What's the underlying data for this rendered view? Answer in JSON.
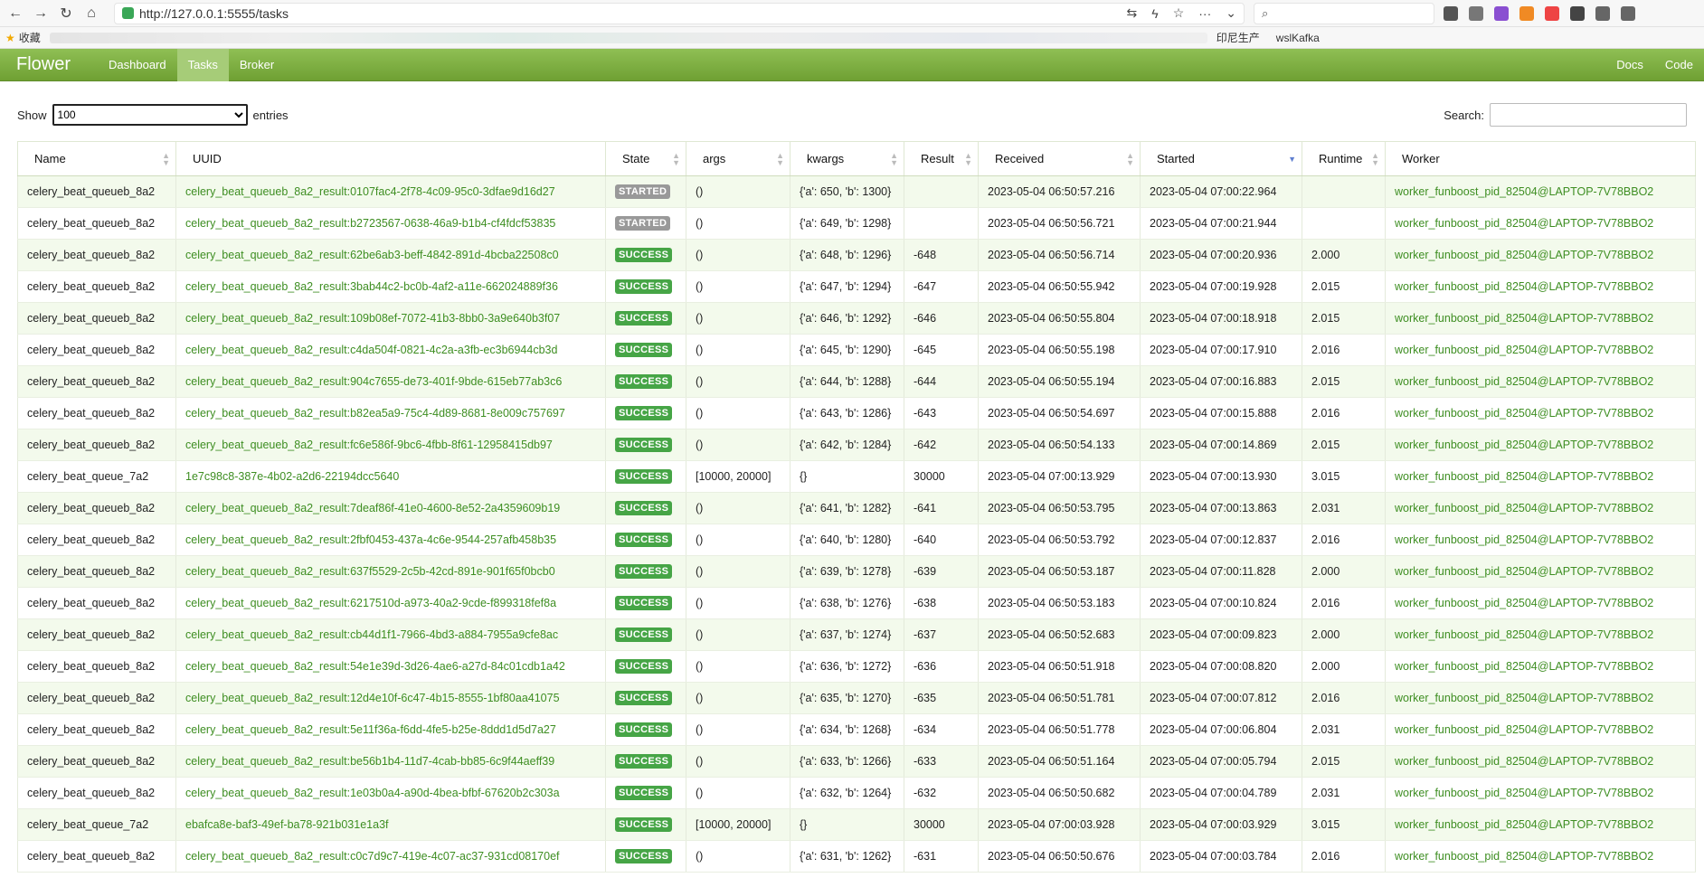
{
  "browser": {
    "url": "http://127.0.0.1:5555/tasks",
    "bookmarks": {
      "favorites": "收藏",
      "item1": "印尼生产",
      "item2": "wslKafka"
    }
  },
  "navbar": {
    "brand": "Flower",
    "links": [
      "Dashboard",
      "Tasks",
      "Broker"
    ],
    "active": "Tasks",
    "right_links": [
      "Docs",
      "Code"
    ]
  },
  "controls": {
    "show_label": "Show",
    "entries_value": "100",
    "entries_label": "entries",
    "search_label": "Search:",
    "search_value": ""
  },
  "table": {
    "columns": [
      "Name",
      "UUID",
      "State",
      "args",
      "kwargs",
      "Result",
      "Received",
      "Started",
      "Runtime",
      "Worker"
    ],
    "sorted_column": "Started",
    "rows": [
      [
        "celery_beat_queueb_8a2",
        "celery_beat_queueb_8a2_result:0107fac4-2f78-4c09-95c0-3dfae9d16d27",
        "STARTED",
        "()",
        "{'a': 650, 'b': 1300}",
        "",
        "2023-05-04 06:50:57.216",
        "2023-05-04 07:00:22.964",
        "",
        "worker_funboost_pid_82504@LAPTOP-7V78BBO2"
      ],
      [
        "celery_beat_queueb_8a2",
        "celery_beat_queueb_8a2_result:b2723567-0638-46a9-b1b4-cf4fdcf53835",
        "STARTED",
        "()",
        "{'a': 649, 'b': 1298}",
        "",
        "2023-05-04 06:50:56.721",
        "2023-05-04 07:00:21.944",
        "",
        "worker_funboost_pid_82504@LAPTOP-7V78BBO2"
      ],
      [
        "celery_beat_queueb_8a2",
        "celery_beat_queueb_8a2_result:62be6ab3-beff-4842-891d-4bcba22508c0",
        "SUCCESS",
        "()",
        "{'a': 648, 'b': 1296}",
        "-648",
        "2023-05-04 06:50:56.714",
        "2023-05-04 07:00:20.936",
        "2.000",
        "worker_funboost_pid_82504@LAPTOP-7V78BBO2"
      ],
      [
        "celery_beat_queueb_8a2",
        "celery_beat_queueb_8a2_result:3bab44c2-bc0b-4af2-a11e-662024889f36",
        "SUCCESS",
        "()",
        "{'a': 647, 'b': 1294}",
        "-647",
        "2023-05-04 06:50:55.942",
        "2023-05-04 07:00:19.928",
        "2.015",
        "worker_funboost_pid_82504@LAPTOP-7V78BBO2"
      ],
      [
        "celery_beat_queueb_8a2",
        "celery_beat_queueb_8a2_result:109b08ef-7072-41b3-8bb0-3a9e640b3f07",
        "SUCCESS",
        "()",
        "{'a': 646, 'b': 1292}",
        "-646",
        "2023-05-04 06:50:55.804",
        "2023-05-04 07:00:18.918",
        "2.015",
        "worker_funboost_pid_82504@LAPTOP-7V78BBO2"
      ],
      [
        "celery_beat_queueb_8a2",
        "celery_beat_queueb_8a2_result:c4da504f-0821-4c2a-a3fb-ec3b6944cb3d",
        "SUCCESS",
        "()",
        "{'a': 645, 'b': 1290}",
        "-645",
        "2023-05-04 06:50:55.198",
        "2023-05-04 07:00:17.910",
        "2.016",
        "worker_funboost_pid_82504@LAPTOP-7V78BBO2"
      ],
      [
        "celery_beat_queueb_8a2",
        "celery_beat_queueb_8a2_result:904c7655-de73-401f-9bde-615eb77ab3c6",
        "SUCCESS",
        "()",
        "{'a': 644, 'b': 1288}",
        "-644",
        "2023-05-04 06:50:55.194",
        "2023-05-04 07:00:16.883",
        "2.015",
        "worker_funboost_pid_82504@LAPTOP-7V78BBO2"
      ],
      [
        "celery_beat_queueb_8a2",
        "celery_beat_queueb_8a2_result:b82ea5a9-75c4-4d89-8681-8e009c757697",
        "SUCCESS",
        "()",
        "{'a': 643, 'b': 1286}",
        "-643",
        "2023-05-04 06:50:54.697",
        "2023-05-04 07:00:15.888",
        "2.016",
        "worker_funboost_pid_82504@LAPTOP-7V78BBO2"
      ],
      [
        "celery_beat_queueb_8a2",
        "celery_beat_queueb_8a2_result:fc6e586f-9bc6-4fbb-8f61-12958415db97",
        "SUCCESS",
        "()",
        "{'a': 642, 'b': 1284}",
        "-642",
        "2023-05-04 06:50:54.133",
        "2023-05-04 07:00:14.869",
        "2.015",
        "worker_funboost_pid_82504@LAPTOP-7V78BBO2"
      ],
      [
        "celery_beat_queue_7a2",
        "1e7c98c8-387e-4b02-a2d6-22194dcc5640",
        "SUCCESS",
        "[10000, 20000]",
        "{}",
        "30000",
        "2023-05-04 07:00:13.929",
        "2023-05-04 07:00:13.930",
        "3.015",
        "worker_funboost_pid_82504@LAPTOP-7V78BBO2"
      ],
      [
        "celery_beat_queueb_8a2",
        "celery_beat_queueb_8a2_result:7deaf86f-41e0-4600-8e52-2a4359609b19",
        "SUCCESS",
        "()",
        "{'a': 641, 'b': 1282}",
        "-641",
        "2023-05-04 06:50:53.795",
        "2023-05-04 07:00:13.863",
        "2.031",
        "worker_funboost_pid_82504@LAPTOP-7V78BBO2"
      ],
      [
        "celery_beat_queueb_8a2",
        "celery_beat_queueb_8a2_result:2fbf0453-437a-4c6e-9544-257afb458b35",
        "SUCCESS",
        "()",
        "{'a': 640, 'b': 1280}",
        "-640",
        "2023-05-04 06:50:53.792",
        "2023-05-04 07:00:12.837",
        "2.016",
        "worker_funboost_pid_82504@LAPTOP-7V78BBO2"
      ],
      [
        "celery_beat_queueb_8a2",
        "celery_beat_queueb_8a2_result:637f5529-2c5b-42cd-891e-901f65f0bcb0",
        "SUCCESS",
        "()",
        "{'a': 639, 'b': 1278}",
        "-639",
        "2023-05-04 06:50:53.187",
        "2023-05-04 07:00:11.828",
        "2.000",
        "worker_funboost_pid_82504@LAPTOP-7V78BBO2"
      ],
      [
        "celery_beat_queueb_8a2",
        "celery_beat_queueb_8a2_result:6217510d-a973-40a2-9cde-f899318fef8a",
        "SUCCESS",
        "()",
        "{'a': 638, 'b': 1276}",
        "-638",
        "2023-05-04 06:50:53.183",
        "2023-05-04 07:00:10.824",
        "2.016",
        "worker_funboost_pid_82504@LAPTOP-7V78BBO2"
      ],
      [
        "celery_beat_queueb_8a2",
        "celery_beat_queueb_8a2_result:cb44d1f1-7966-4bd3-a884-7955a9cfe8ac",
        "SUCCESS",
        "()",
        "{'a': 637, 'b': 1274}",
        "-637",
        "2023-05-04 06:50:52.683",
        "2023-05-04 07:00:09.823",
        "2.000",
        "worker_funboost_pid_82504@LAPTOP-7V78BBO2"
      ],
      [
        "celery_beat_queueb_8a2",
        "celery_beat_queueb_8a2_result:54e1e39d-3d26-4ae6-a27d-84c01cdb1a42",
        "SUCCESS",
        "()",
        "{'a': 636, 'b': 1272}",
        "-636",
        "2023-05-04 06:50:51.918",
        "2023-05-04 07:00:08.820",
        "2.000",
        "worker_funboost_pid_82504@LAPTOP-7V78BBO2"
      ],
      [
        "celery_beat_queueb_8a2",
        "celery_beat_queueb_8a2_result:12d4e10f-6c47-4b15-8555-1bf80aa41075",
        "SUCCESS",
        "()",
        "{'a': 635, 'b': 1270}",
        "-635",
        "2023-05-04 06:50:51.781",
        "2023-05-04 07:00:07.812",
        "2.016",
        "worker_funboost_pid_82504@LAPTOP-7V78BBO2"
      ],
      [
        "celery_beat_queueb_8a2",
        "celery_beat_queueb_8a2_result:5e11f36a-f6dd-4fe5-b25e-8ddd1d5d7a27",
        "SUCCESS",
        "()",
        "{'a': 634, 'b': 1268}",
        "-634",
        "2023-05-04 06:50:51.778",
        "2023-05-04 07:00:06.804",
        "2.031",
        "worker_funboost_pid_82504@LAPTOP-7V78BBO2"
      ],
      [
        "celery_beat_queueb_8a2",
        "celery_beat_queueb_8a2_result:be56b1b4-11d7-4cab-bb85-6c9f44aeff39",
        "SUCCESS",
        "()",
        "{'a': 633, 'b': 1266}",
        "-633",
        "2023-05-04 06:50:51.164",
        "2023-05-04 07:00:05.794",
        "2.015",
        "worker_funboost_pid_82504@LAPTOP-7V78BBO2"
      ],
      [
        "celery_beat_queueb_8a2",
        "celery_beat_queueb_8a2_result:1e03b0a4-a90d-4bea-bfbf-67620b2c303a",
        "SUCCESS",
        "()",
        "{'a': 632, 'b': 1264}",
        "-632",
        "2023-05-04 06:50:50.682",
        "2023-05-04 07:00:04.789",
        "2.031",
        "worker_funboost_pid_82504@LAPTOP-7V78BBO2"
      ],
      [
        "celery_beat_queue_7a2",
        "ebafca8e-baf3-49ef-ba78-921b031e1a3f",
        "SUCCESS",
        "[10000, 20000]",
        "{}",
        "30000",
        "2023-05-04 07:00:03.928",
        "2023-05-04 07:00:03.929",
        "3.015",
        "worker_funboost_pid_82504@LAPTOP-7V78BBO2"
      ],
      [
        "celery_beat_queueb_8a2",
        "celery_beat_queueb_8a2_result:c0c7d9c7-419e-4c07-ac37-931cd08170ef",
        "SUCCESS",
        "()",
        "{'a': 631, 'b': 1262}",
        "-631",
        "2023-05-04 06:50:50.676",
        "2023-05-04 07:00:03.784",
        "2.016",
        "worker_funboost_pid_82504@LAPTOP-7V78BBO2"
      ]
    ]
  },
  "colors": {
    "navbar": "#7aaf3e",
    "link": "#3e8e22",
    "success": "#46a546",
    "started": "#999999"
  }
}
